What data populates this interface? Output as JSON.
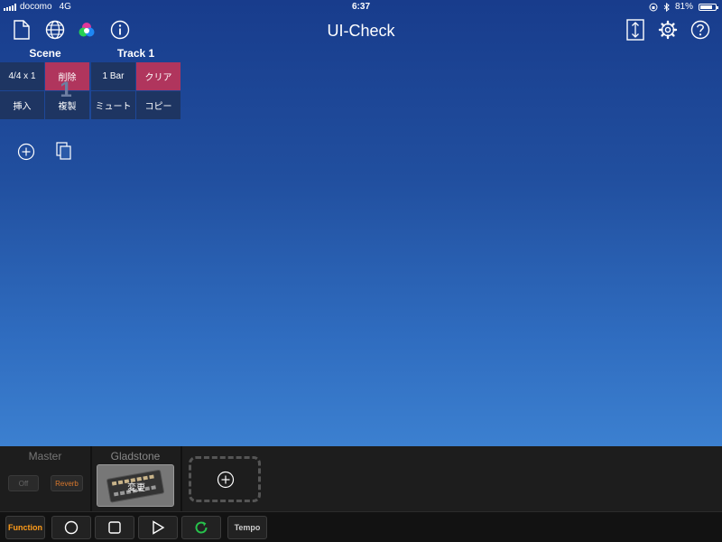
{
  "status_bar": {
    "carrier": "docomo",
    "network": "4G",
    "time": "6:37",
    "battery_text": "81%",
    "battery_level": 0.81
  },
  "header": {
    "title": "UI-Check"
  },
  "scene": {
    "title": "Scene",
    "time_sig": "4/4 x 1",
    "delete_label": "削除",
    "insert_label": "挿入",
    "duplicate_label": "複製",
    "number": "1"
  },
  "track": {
    "title": "Track 1",
    "length": "1 Bar",
    "clear_label": "クリア",
    "mute_label": "ミュート",
    "copy_label": "コピー"
  },
  "bottom": {
    "master_label": "Master",
    "off_label": "Off",
    "reverb_label": "Reverb",
    "instrument_label": "Gladstone",
    "change_label": "変更"
  },
  "transport": {
    "function_label": "Function",
    "tempo_label": "Tempo"
  },
  "colors": {
    "accent_red": "#b0355d",
    "function_orange": "#ff9c1a",
    "loop_green": "#27c24c",
    "reverb_orange": "#d9782c"
  }
}
